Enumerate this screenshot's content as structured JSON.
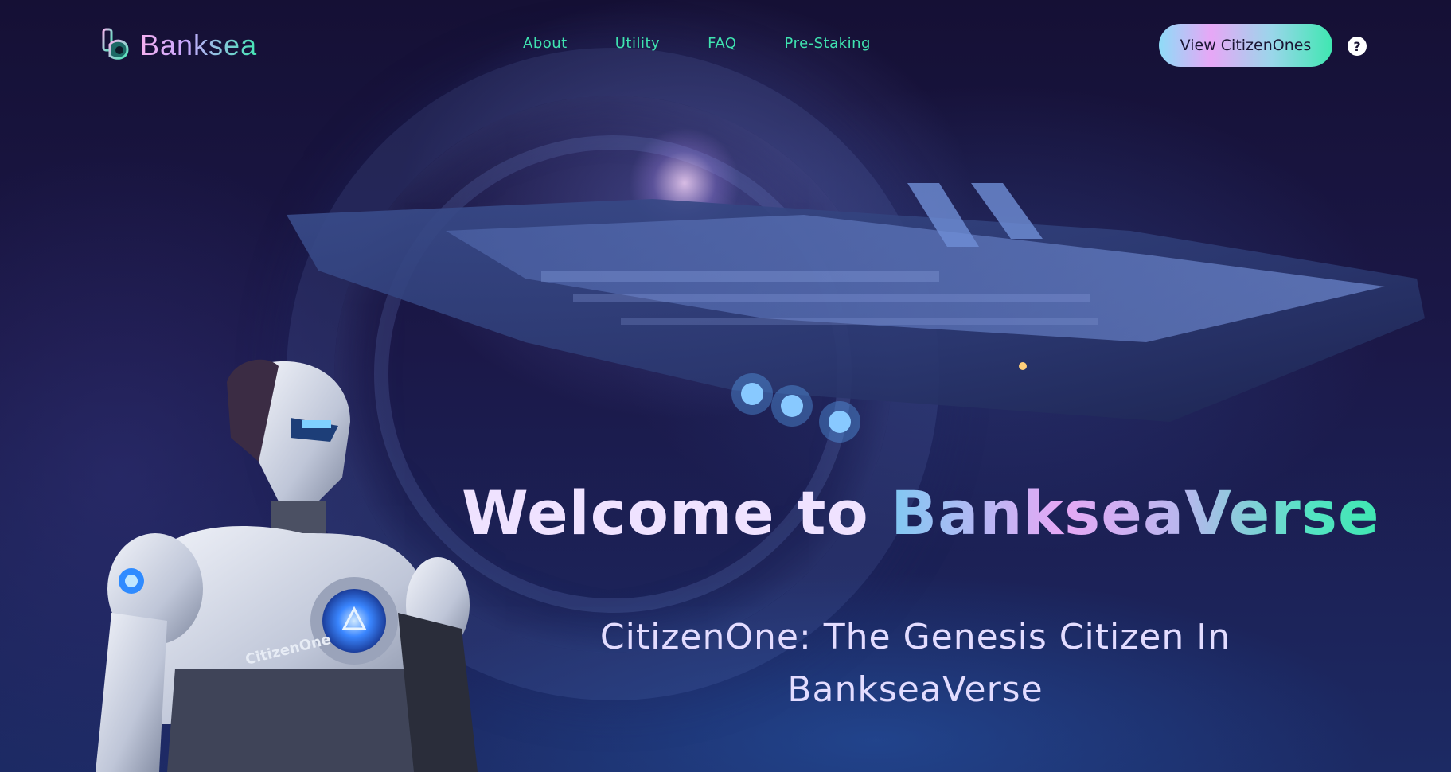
{
  "brand": {
    "name": "Banksea"
  },
  "nav": {
    "items": [
      {
        "label": "About"
      },
      {
        "label": "Utility"
      },
      {
        "label": "FAQ"
      },
      {
        "label": "Pre-Staking"
      }
    ]
  },
  "header": {
    "cta_label": "View CitizenOnes",
    "help_label": "?"
  },
  "hero": {
    "headline_white": "Welcome to ",
    "headline_gradient": "BankseaVerse",
    "subtitle_line1": "CitizenOne: The Genesis Citizen In",
    "subtitle_line2": "BankseaVerse",
    "robot_chest_text": "CitizenOne"
  },
  "colors": {
    "background": "#130f33",
    "nav_link": "#3fe3b0",
    "accent_pink": "#e7a7f6",
    "accent_green": "#3fe7b1",
    "accent_blue": "#8edcf7"
  },
  "icons": [
    "banksea-logo-icon",
    "help-icon"
  ]
}
